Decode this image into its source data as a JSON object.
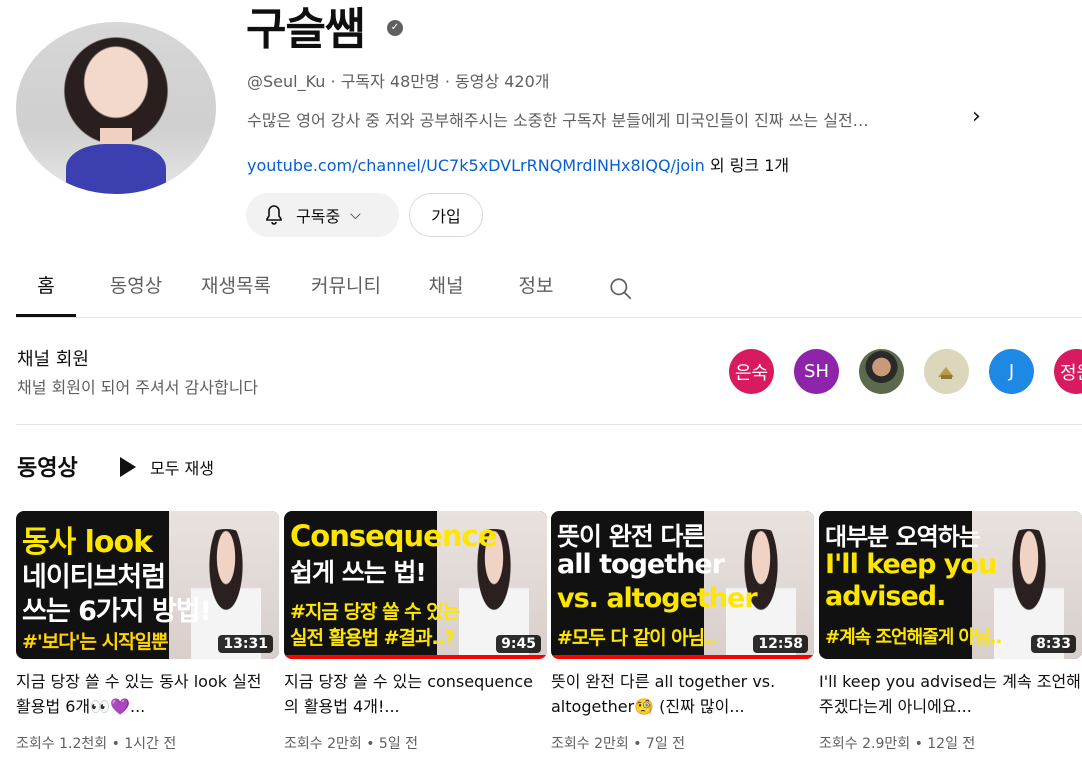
{
  "channel": {
    "name": "구슬쌤",
    "verified_icon": "check-circle-icon",
    "handle": "@Seul_Ku",
    "subscribers": "구독자 48만명",
    "video_count": "동영상 420개",
    "description": "수많은 영어 강사 중 저와 공부해주시는 소중한 구독자 분들에게 미국인들이 진짜 쓰는 실전…",
    "link": "youtube.com/channel/UC7k5xDVLrRNQMrdlNHx8IQQ/join",
    "more_links": "외 링크 1개",
    "subscribed_label": "구독중",
    "join_label": "가입"
  },
  "tabs": [
    "홈",
    "동영상",
    "재생목록",
    "커뮤니티",
    "채널",
    "정보"
  ],
  "members": {
    "title": "채널 회원",
    "subtitle": "채널 회원이 되어 주셔서 감사합니다",
    "avatars": [
      {
        "label": "은숙",
        "color": "#d81b60"
      },
      {
        "label": "SH",
        "color": "#8e24aa"
      },
      {
        "label": "",
        "color": "#3a2c22"
      },
      {
        "label": "",
        "color": "#d9d3b8"
      },
      {
        "label": "J",
        "color": "#1e88e5"
      },
      {
        "label": "정원",
        "color": "#d81b60"
      }
    ]
  },
  "videos_section": {
    "title": "동영상",
    "play_all": "모두 재생",
    "items": [
      {
        "thumb_line1": "동사 look",
        "thumb_line2": "네이티브처럼",
        "thumb_line3": "쓰는 6가지 방법!",
        "thumb_hash": "#'보다'는 시작일뿐",
        "duration": "13:31",
        "title": "지금 당장 쓸 수 있는 동사 look 실전 활용법 6개👀💜...",
        "meta": "조회수 1.2천회 • 1시간 전",
        "progress": 0
      },
      {
        "thumb_line1": "Consequence",
        "thumb_line2": "쉽게 쓰는 법!",
        "thumb_line3": "#지금 당장 쓸 수 있는",
        "thumb_hash": "실전 활용법 #결과..?",
        "duration": "9:45",
        "title": "지금 당장 쓸 수 있는 consequence의 활용법 4개!...",
        "meta": "조회수 2만회 • 5일 전",
        "progress": 1.0
      },
      {
        "thumb_line1": "뜻이 완전 다른",
        "thumb_line2": "all together",
        "thumb_line3": "vs. altogether",
        "thumb_hash": "#모두 다 같이 아님..",
        "duration": "12:58",
        "title": "뜻이 완전 다른 all together vs. altogether🧐 (진짜 많이...",
        "meta": "조회수 2만회 • 7일 전",
        "progress": 1.0
      },
      {
        "thumb_line1": "대부분 오역하는",
        "thumb_line2": "I'll keep you",
        "thumb_line3": "advised.",
        "thumb_hash": "#계속 조언해줄게 아님..",
        "duration": "8:33",
        "title": "I'll keep you advised는 계속 조언해주겠다는게 아니에요...",
        "meta": "조회수 2.9만회 • 12일 전",
        "progress": 0
      }
    ]
  }
}
